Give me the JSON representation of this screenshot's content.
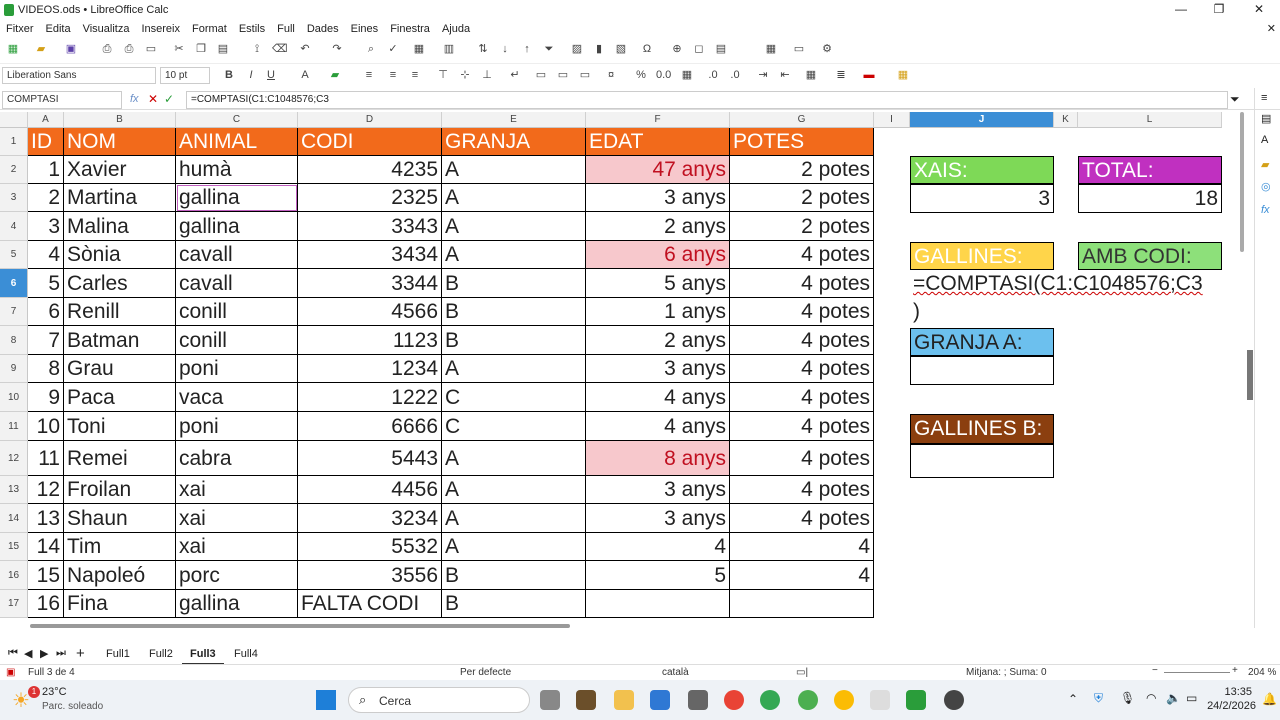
{
  "window": {
    "title": "VIDEOS.ods • LibreOffice Calc"
  },
  "menu": [
    "Fitxer",
    "Edita",
    "Visualitza",
    "Insereix",
    "Format",
    "Estils",
    "Full",
    "Dades",
    "Eines",
    "Finestra",
    "Ajuda"
  ],
  "toolbar2": {
    "font": "Liberation Sans",
    "size": "10 pt"
  },
  "formula": {
    "namebox": "COMPTASI",
    "content": "=COMPTASI(C1:C1048576;C3"
  },
  "columns": [
    "A",
    "B",
    "C",
    "D",
    "E",
    "F",
    "G",
    "I",
    "J",
    "K",
    "L"
  ],
  "rows": [
    "1",
    "2",
    "3",
    "4",
    "5",
    "6",
    "7",
    "8",
    "9",
    "10",
    "11",
    "12",
    "13",
    "14",
    "15",
    "16",
    "17"
  ],
  "header": [
    "ID",
    "NOM",
    "ANIMAL",
    "CODI",
    "GRANJA",
    "EDAT",
    "POTES"
  ],
  "table": [
    [
      "1",
      "Xavier",
      "humà",
      "4235",
      "A",
      "47 anys",
      "2 potes"
    ],
    [
      "2",
      "Martina",
      "gallina",
      "2325",
      "A",
      "3 anys",
      "2 potes"
    ],
    [
      "3",
      "Malina",
      "gallina",
      "3343",
      "A",
      "2 anys",
      "2 potes"
    ],
    [
      "4",
      "Sònia",
      "cavall",
      "3434",
      "A",
      "6 anys",
      "4 potes"
    ],
    [
      "5",
      "Carles",
      "cavall",
      "3344",
      "B",
      "5 anys",
      "4 potes"
    ],
    [
      "6",
      "Renill",
      "conill",
      "4566",
      "B",
      "1 anys",
      "4 potes"
    ],
    [
      "7",
      "Batman",
      "conill",
      "1123",
      "B",
      "2 anys",
      "4 potes"
    ],
    [
      "8",
      "Grau",
      "poni",
      "1234",
      "A",
      "3 anys",
      "4 potes"
    ],
    [
      "9",
      "Paca",
      "vaca",
      "1222",
      "C",
      "4 anys",
      "4 potes"
    ],
    [
      "10",
      "Toni",
      "poni",
      "6666",
      "C",
      "4 anys",
      "4 potes"
    ],
    [
      "11",
      "Remei",
      "cabra",
      "5443",
      "A",
      "8 anys",
      "4 potes"
    ],
    [
      "12",
      "Froilan",
      "xai",
      "4456",
      "A",
      "3 anys",
      "4 potes"
    ],
    [
      "13",
      "Shaun",
      "xai",
      "3234",
      "A",
      "3 anys",
      "4 potes"
    ],
    [
      "14",
      "Tim",
      "xai",
      "5532",
      "A",
      "4",
      "4"
    ],
    [
      "15",
      "Napoleó",
      "porc",
      "3556",
      "B",
      "5",
      "4"
    ],
    [
      "16",
      "Fina",
      "gallina",
      "FALTA CODI",
      "B",
      "",
      ""
    ]
  ],
  "side": {
    "xais_label": "XAIS:",
    "xais_value": "3",
    "total_label": "TOTAL:",
    "total_value": "18",
    "gallines_label": "GALLINES:",
    "ambcodi_label": "AMB CODI:",
    "editing_formula": "=COMPTASI(C1:C1048576;C3",
    "editing_paren": ")",
    "granja_a_label": "GRANJA A:",
    "gallines_b_label": "GALLINES B:"
  },
  "colors": {
    "header_orange": "#f26a1b",
    "pink": "#f7c8cc",
    "green": "#7ed957",
    "magenta": "#c030c0",
    "yellow": "#ffd54a",
    "lightgreen": "#8de07a",
    "blue": "#6cc0ee",
    "brown": "#8b3f0f"
  },
  "sheets": [
    "Full1",
    "Full2",
    "Full3",
    "Full4"
  ],
  "active_sheet": "Full3",
  "status": {
    "sheet": "Full 3 de 4",
    "style": "Per defecte",
    "lang": "català",
    "sum": "Mitjana: ; Suma: 0",
    "zoom": "204 %"
  },
  "taskbar": {
    "temp": "23°C",
    "weather": "Parc. soleado",
    "search": "Cerca",
    "time": "13:35",
    "date": "24/2/2026",
    "badge": "1"
  }
}
